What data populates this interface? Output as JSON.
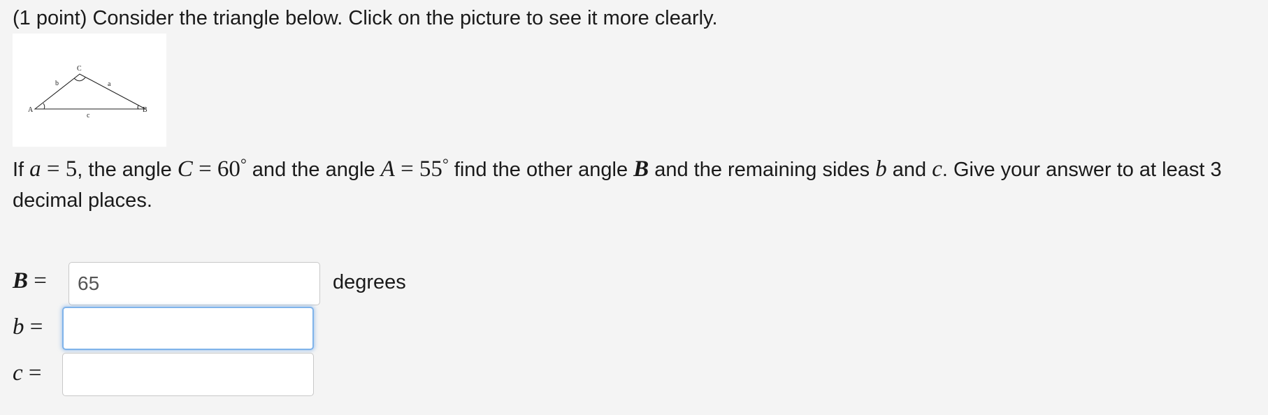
{
  "intro": {
    "points": "(1 point)",
    "text": " Consider the triangle below. Click on the picture to see it more clearly."
  },
  "figure": {
    "vertex_labels": {
      "A": "A",
      "B": "B",
      "C": "C"
    },
    "side_labels": {
      "a": "a",
      "b": "b",
      "c": "c"
    }
  },
  "question": {
    "p1": "If ",
    "a_var": "a",
    "eq1": " = 5",
    "p2": ", the angle ",
    "C_var": "C",
    "eq2": " = 60",
    "deg1": "°",
    "p3": " and the angle ",
    "A_var": "A",
    "eq3": " = 55",
    "deg2": "°",
    "p4": " find the other angle ",
    "B_var": "B",
    "p5": " and the remaining sides ",
    "b_var": "b",
    "p6": " and ",
    "c_var": "c",
    "p7": ". Give your answer to at least 3 decimal places."
  },
  "answers": {
    "B": {
      "var": "B",
      "eq": " =",
      "value": "65",
      "unit": "degrees"
    },
    "b": {
      "var": "b",
      "eq": " =",
      "value": ""
    },
    "c": {
      "var": "c",
      "eq": " =",
      "value": ""
    }
  }
}
